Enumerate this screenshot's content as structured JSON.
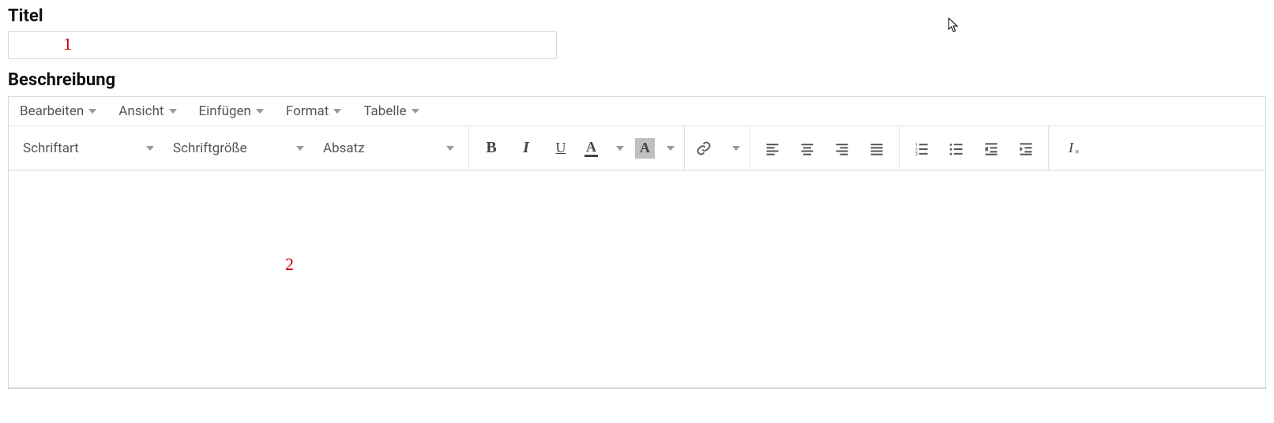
{
  "labels": {
    "title": "Titel",
    "description": "Beschreibung"
  },
  "title_input": {
    "value": "",
    "placeholder": ""
  },
  "annotations": {
    "one": "1",
    "two": "2"
  },
  "menubar": {
    "edit": "Bearbeiten",
    "view": "Ansicht",
    "insert": "Einfügen",
    "format": "Format",
    "table": "Tabelle"
  },
  "toolbar": {
    "font_family": "Schriftart",
    "font_size": "Schriftgröße",
    "block_format": "Absatz"
  }
}
